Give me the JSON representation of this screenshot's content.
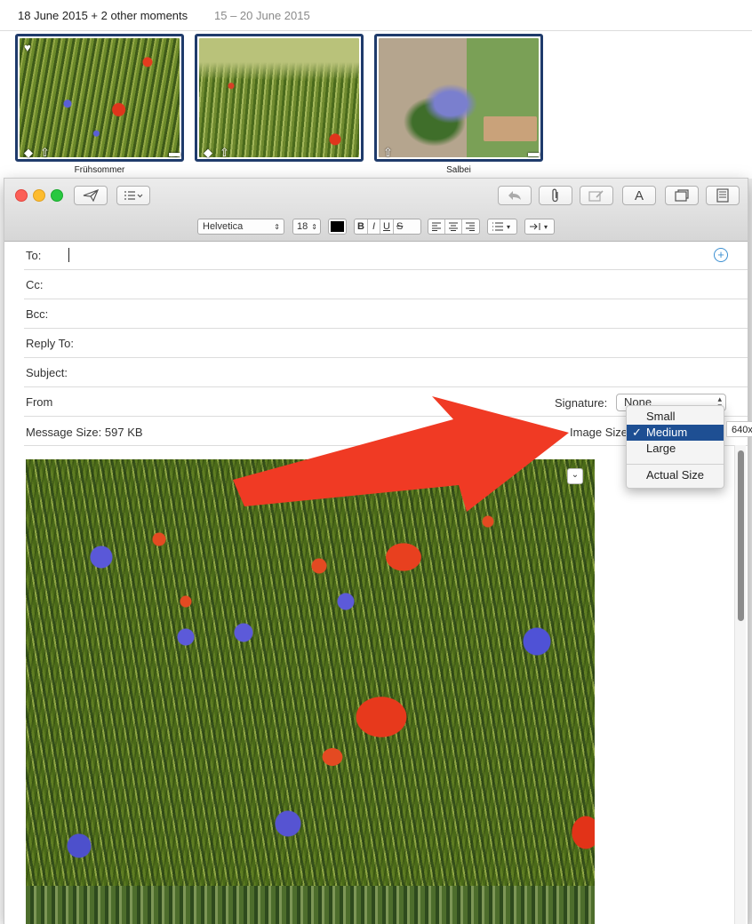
{
  "photos": {
    "header_title": "18 June 2015 + 2 other moments",
    "header_dates": "15 – 20 June 2015",
    "thumbnails": [
      {
        "caption": "Frühsommer"
      },
      {
        "caption": ""
      },
      {
        "caption": "Salbei"
      }
    ]
  },
  "mail": {
    "format_bar": {
      "font": "Helvetica",
      "size": "18",
      "bold": "B",
      "italic": "I",
      "underline": "U",
      "strike": "S"
    },
    "toolbar": {
      "text_label": "A"
    },
    "fields": {
      "to": "To:",
      "cc": "Cc:",
      "bcc": "Bcc:",
      "reply_to": "Reply To:",
      "subject": "Subject:",
      "from": "From",
      "signature_label": "Signature:",
      "signature_value": "None",
      "message_size_label": "Message Size:",
      "message_size_value": "597 KB",
      "image_size_label": "Image Size"
    },
    "image_size_menu": {
      "options": [
        "Small",
        "Medium",
        "Large",
        "Actual Size"
      ],
      "selected": "Medium",
      "check": "✓"
    },
    "size_tooltip": "640x"
  },
  "colors": {
    "accent_selection": "#1e4f93",
    "thumb_border": "#1f3b6b",
    "arrow": "#f03a24"
  }
}
